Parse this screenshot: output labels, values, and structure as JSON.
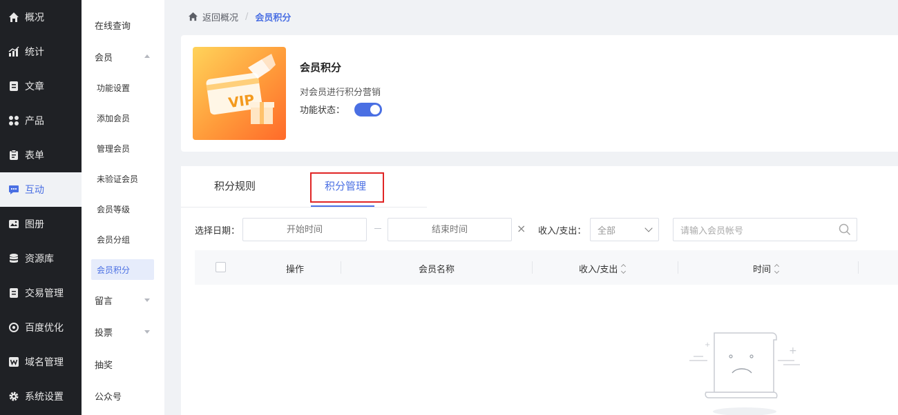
{
  "left_nav": [
    {
      "label": "概况",
      "icon": "home-icon"
    },
    {
      "label": "统计",
      "icon": "chart-icon"
    },
    {
      "label": "文章",
      "icon": "document-icon"
    },
    {
      "label": "产品",
      "icon": "grid-icon"
    },
    {
      "label": "表单",
      "icon": "clipboard-icon"
    },
    {
      "label": "互动",
      "icon": "chat-icon",
      "active": true
    },
    {
      "label": "图册",
      "icon": "image-icon"
    },
    {
      "label": "资源库",
      "icon": "database-icon"
    },
    {
      "label": "交易管理",
      "icon": "wallet-icon"
    },
    {
      "label": "百度优化",
      "icon": "target-icon"
    },
    {
      "label": "域名管理",
      "icon": "w-icon"
    },
    {
      "label": "系统设置",
      "icon": "gear-icon"
    }
  ],
  "sub_nav": {
    "online_query": "在线查询",
    "member": "会员",
    "member_children": [
      "功能设置",
      "添加会员",
      "管理会员",
      "未验证会员",
      "会员等级",
      "会员分组",
      "会员积分"
    ],
    "message": "留言",
    "vote": "投票",
    "lottery": "抽奖",
    "official_account": "公众号"
  },
  "breadcrumb": {
    "back": "返回概况",
    "separator": "/",
    "current": "会员积分"
  },
  "feature": {
    "image_text": "VIP",
    "title": "会员积分",
    "description": "对会员进行积分营销",
    "status_label": "功能状态：",
    "enabled": true
  },
  "tabs": {
    "rules": "积分规则",
    "management": "积分管理"
  },
  "filters": {
    "date_label": "选择日期：",
    "start_placeholder": "开始时间",
    "end_placeholder": "结束时间",
    "clear": "×",
    "type_label": "收入/支出：",
    "type_value": "全部",
    "search_placeholder": "请输入会员帐号"
  },
  "table": {
    "headers": [
      "操作",
      "会员名称",
      "收入/支出",
      "时间"
    ]
  },
  "colors": {
    "accent": "#4a6fe3",
    "nav_bg": "#1f2125",
    "highlight": "#e02424"
  }
}
